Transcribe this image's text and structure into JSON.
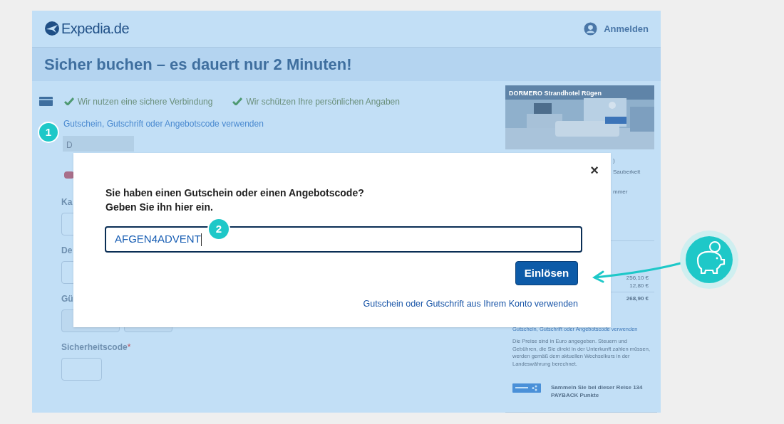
{
  "header": {
    "logo_text": "Expedia.de",
    "signin": "Anmelden"
  },
  "title": "Sicher buchen – es dauert nur 2 Minuten!",
  "trust": [
    "Wir nutzen eine sichere Verbindung",
    "Wir schützen Ihre persönlichen Angaben"
  ],
  "voucher_link": "Gutschein, Gutschrift oder Angebotscode verwenden",
  "tab": {
    "label": "D",
    "selected": true
  },
  "form": [
    {
      "label": "Ka",
      "kind": "input"
    },
    {
      "label": "De",
      "kind": "input"
    },
    {
      "label": "Gü",
      "kind": "selects"
    },
    {
      "label": "Sicherheitscode",
      "kind": "small",
      "required_mark": "*"
    }
  ],
  "summary": {
    "hotel_name": "DORMERO Strandhotel Rügen",
    "fragments": [
      ")",
      "Sauberkeit",
      "mmer"
    ],
    "prices": [
      "256,10 €",
      "12,80 €"
    ],
    "total": "268,90 €",
    "link": "Gutschein, Gutschrift oder Angebotscode verwenden",
    "note": "Die Preise sind in Euro angegeben. Steuern und Gebühren, die Sie direkt in der Unterkunft zahlen müssen, werden gemäß dem aktuellen Wechselkurs in der Landeswährung berechnet.",
    "payback": "Sammeln Sie bei dieser Reise 134 PAYBACK Punkte"
  },
  "modal": {
    "heading": [
      "Sie haben einen Gutschein oder einen Angebotscode?",
      "Geben Sie ihn hier ein."
    ],
    "close": "×",
    "code": "AFGEN4ADVENT",
    "button": "Einlösen",
    "account_link": "Gutschein oder Gutschrift aus Ihrem Konto verwenden"
  },
  "annotations": [
    {
      "number": "1"
    },
    {
      "number": "2"
    }
  ]
}
